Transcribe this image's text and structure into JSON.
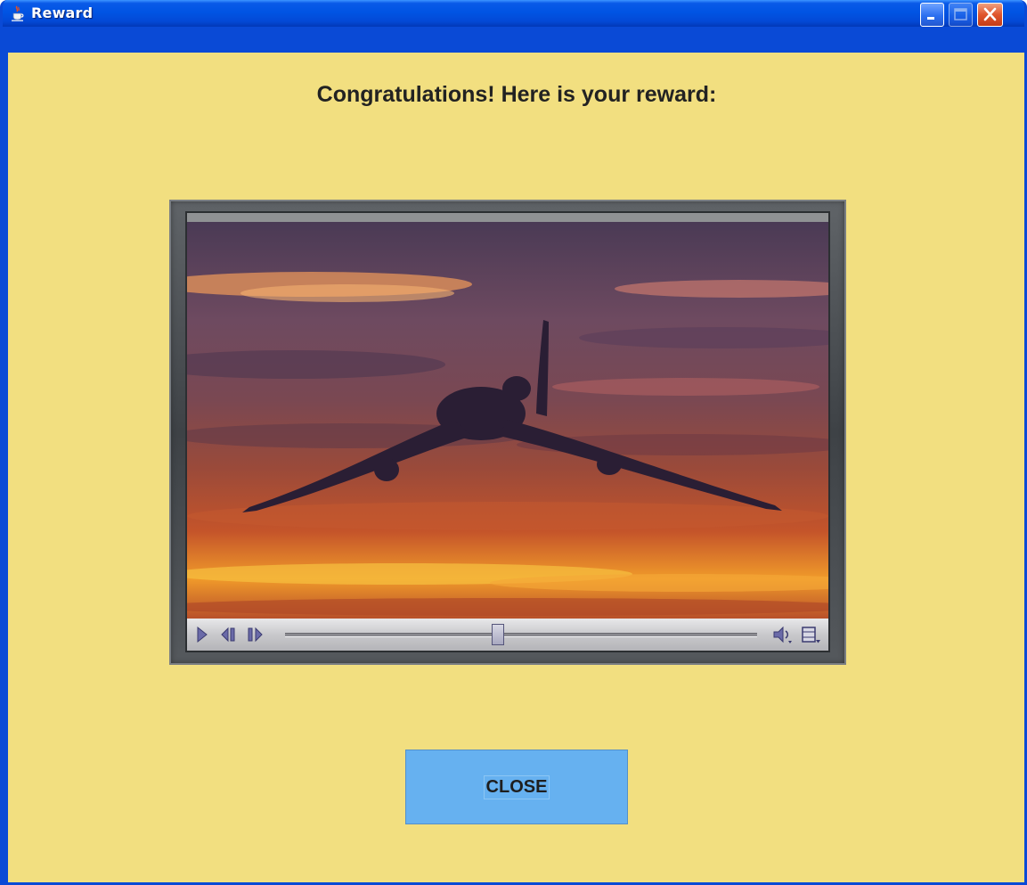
{
  "window": {
    "title": "Reward",
    "title_icon": "java-cup-icon",
    "controls": [
      "minimize-icon",
      "maximize-icon",
      "close-icon"
    ],
    "accent_color": "#0054e3",
    "background_color": "#f2df80"
  },
  "content": {
    "heading": "Congratulations! Here is your reward:"
  },
  "media_player": {
    "playback_position": 0.45,
    "controls": [
      "play-icon",
      "step-back-icon",
      "step-forward-icon",
      "volume-icon",
      "film-menu-icon"
    ]
  },
  "actions": {
    "close_label": "CLOSE",
    "close_color": "#66b1f0"
  }
}
